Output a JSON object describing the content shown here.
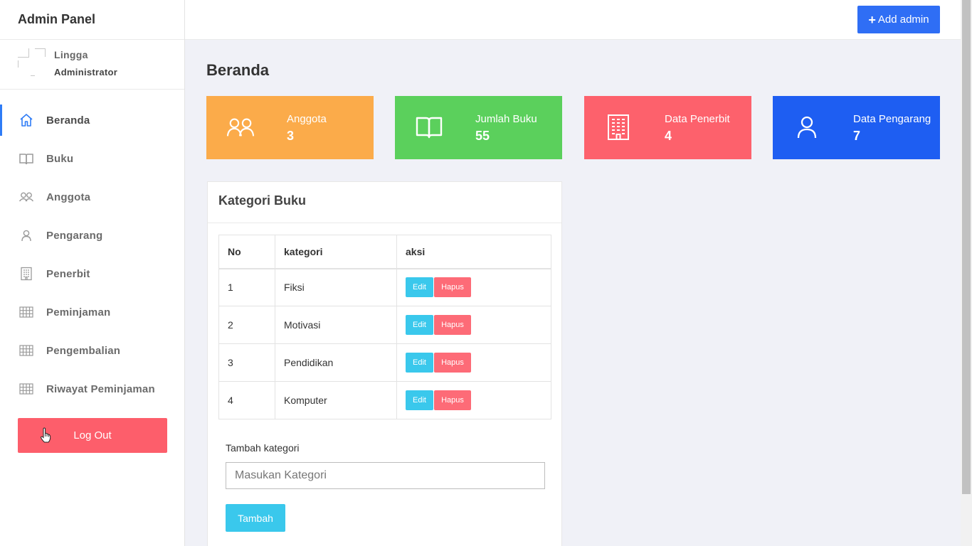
{
  "sidebar": {
    "brand": "Admin Panel",
    "profile": {
      "name": "Lingga",
      "role": "Administrator"
    },
    "items": [
      {
        "label": "Beranda",
        "icon": "home-icon",
        "active": true
      },
      {
        "label": "Buku",
        "icon": "book-icon"
      },
      {
        "label": "Anggota",
        "icon": "users-icon"
      },
      {
        "label": "Pengarang",
        "icon": "user-icon"
      },
      {
        "label": "Penerbit",
        "icon": "building-icon"
      },
      {
        "label": "Peminjaman",
        "icon": "table-icon"
      },
      {
        "label": "Pengembalian",
        "icon": "table-icon"
      },
      {
        "label": "Riwayat Peminjaman",
        "icon": "table-icon"
      }
    ],
    "logout_label": "Log Out"
  },
  "topbar": {
    "add_admin_label": "Add admin"
  },
  "main": {
    "title": "Beranda",
    "stats": [
      {
        "label": "Anggota",
        "value": "3",
        "color": "#fbab4a",
        "icon": "users-icon"
      },
      {
        "label": "Jumlah Buku",
        "value": "55",
        "color": "#5bd05c",
        "icon": "book-icon"
      },
      {
        "label": "Data Penerbit",
        "value": "4",
        "color": "#fd616c",
        "icon": "building-icon"
      },
      {
        "label": "Data Pengarang",
        "value": "7",
        "color": "#1e5ef2",
        "icon": "user-icon"
      }
    ],
    "category_card": {
      "title": "Kategori Buku",
      "columns": [
        "No",
        "kategori",
        "aksi"
      ],
      "rows": [
        {
          "no": "1",
          "kategori": "Fiksi"
        },
        {
          "no": "2",
          "kategori": "Motivasi"
        },
        {
          "no": "3",
          "kategori": "Pendidikan"
        },
        {
          "no": "4",
          "kategori": "Komputer"
        }
      ],
      "edit_label": "Edit",
      "delete_label": "Hapus",
      "form_label": "Tambah kategori",
      "input_placeholder": "Masukan Kategori",
      "submit_label": "Tambah"
    }
  }
}
